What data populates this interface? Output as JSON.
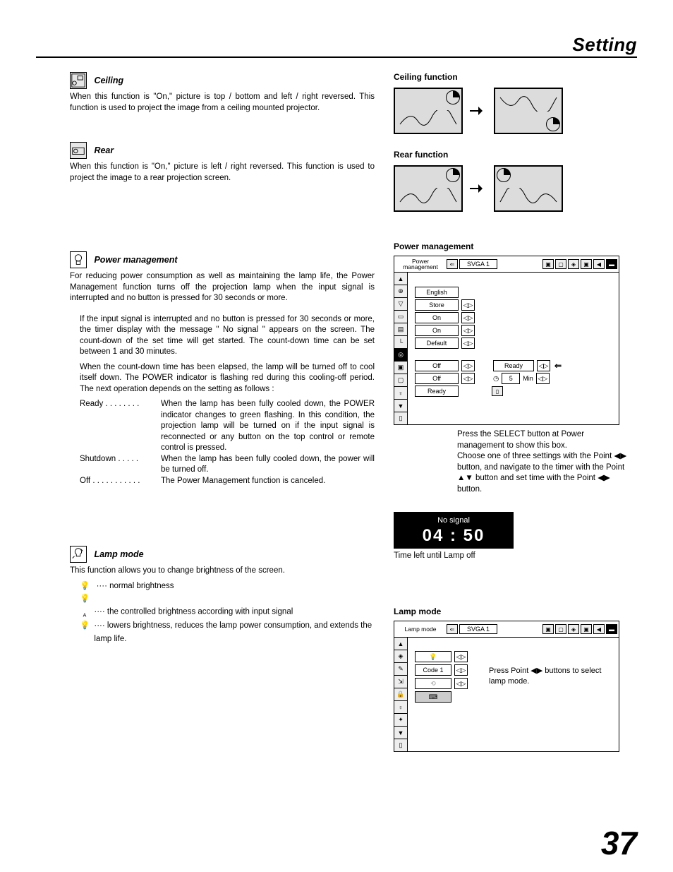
{
  "page": {
    "header": "Setting",
    "number": "37"
  },
  "ceiling": {
    "title": "Ceiling",
    "body": "When this function is \"On,\" picture is top / bottom and left / right reversed.  This function is used to project the image from a ceiling mounted projector.",
    "fig_title": "Ceiling function"
  },
  "rear": {
    "title": "Rear",
    "body": "When this function is \"On,\" picture is left / right reversed.  This function is used to project the image to a rear projection screen.",
    "fig_title": "Rear function"
  },
  "power_mgmt": {
    "title": "Power management",
    "body1": "For reducing power consumption as well as maintaining the lamp life, the Power Management function turns off the projection lamp when the input signal is interrupted and no button is pressed for 30 seconds or more.",
    "body2": "If the input signal is interrupted and no button is pressed for 30 seconds or more, the timer display with the message \" No signal \" appears on the screen. The count-down of the set time will get started. The count-down time can be set between 1 and 30 minutes.",
    "body3": "When the count-down time has been elapsed, the lamp will be turned off to cool itself down. The POWER indicator is flashing red during this cooling-off period. The next operation depends on the setting as follows :",
    "modes": {
      "ready": {
        "label": "Ready . . . . . . . .",
        "desc": "When the lamp has been fully cooled down, the POWER indicator changes to green flashing. In this condition, the projection lamp will be turned on if the input signal is reconnected or any button on the top control or remote control is pressed."
      },
      "shutdown": {
        "label": "Shutdown . . . . .",
        "desc": "When the lamp has been fully cooled down, the power will be turned off."
      },
      "off": {
        "label": "Off . . . . . . . . . . .",
        "desc": "The Power Management function is canceled."
      }
    },
    "fig_title": "Power management",
    "osd": {
      "header_title": "Power\nmanagement",
      "signal": "SVGA 1",
      "rows": {
        "lang": "English",
        "store": "Store",
        "on1": "On",
        "on2": "On",
        "default": "Default",
        "off1": "Off",
        "off2": "Off",
        "ready": "Ready"
      },
      "panel": {
        "ready": "Ready",
        "minutes": "5",
        "min_label": "Min"
      }
    },
    "caption1": "Press the SELECT button at Power management to show this box.",
    "caption2": "Choose one of three settings with the Point ◀▶ button, and navigate to the timer with the Point ▲▼ button and set time with the Point ◀▶ button.",
    "nosignal": {
      "msg": "No signal",
      "time": "04 : 50",
      "caption": "Time left until Lamp off"
    }
  },
  "lamp_mode": {
    "title": "Lamp mode",
    "intro": "This function allows you to change brightness of the screen.",
    "items": {
      "normal": "···· normal brightness",
      "auto": "···· the controlled brightness according with input signal",
      "eco": "···· lowers brightness, reduces the lamp power consumption, and extends the lamp life."
    },
    "fig_title": "Lamp mode",
    "osd": {
      "header_title": "Lamp mode",
      "signal": "SVGA 1",
      "rows": {
        "lamp_icon": "💡",
        "code": "Code 1",
        "rc_icon": "⌨"
      }
    },
    "caption": "Press Point ◀▶ buttons to select lamp mode."
  }
}
